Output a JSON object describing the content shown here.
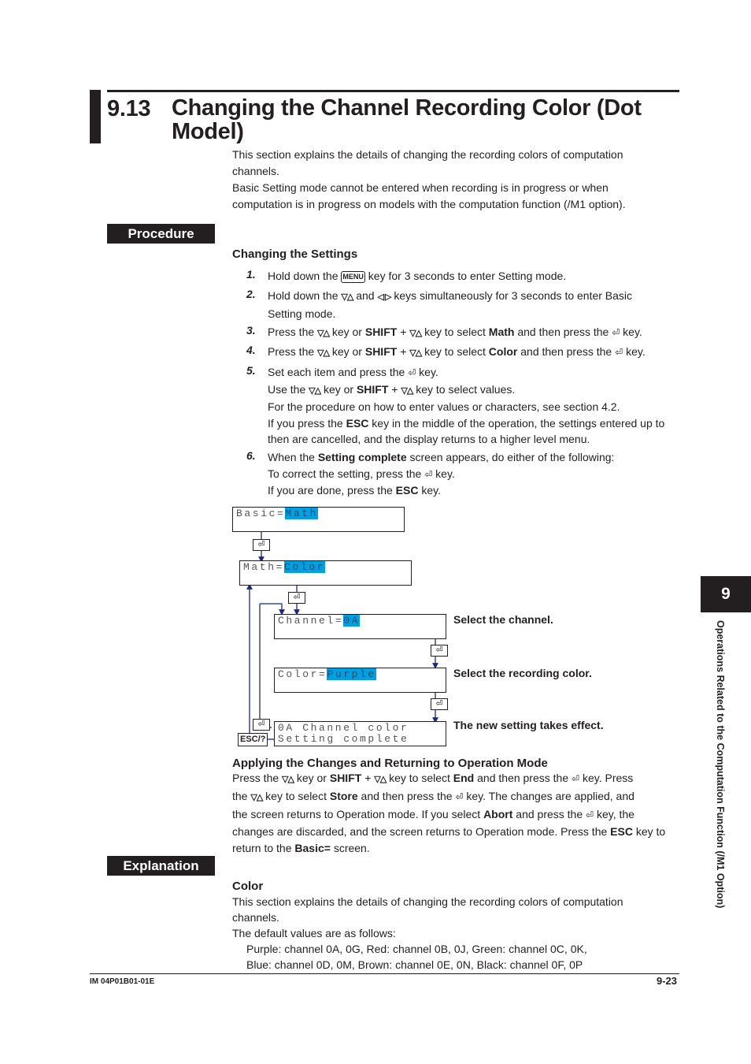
{
  "title": {
    "number": "9.13",
    "text": "Changing the Channel Recording Color (Dot Model)"
  },
  "intro": [
    "This section explains the details of changing the recording colors of computation channels.",
    "Basic Setting mode cannot be entered when recording is in progress or when computation is in progress on models with the computation function (/M1 option)."
  ],
  "procedure": {
    "tab_label": "Procedure",
    "heading": "Changing the Settings",
    "steps": [
      {
        "num": "1.",
        "parts": [
          "Hold down the ",
          "MENU",
          " key for 3 seconds to enter Setting mode."
        ]
      },
      {
        "num": "2.",
        "parts": [
          "Hold down the ",
          "▽△",
          " and ",
          "◁ ▷",
          " keys simultaneously for 3 seconds to enter Basic Setting mode."
        ]
      },
      {
        "num": "3.",
        "parts": [
          "Press the ",
          "▽△",
          " key or ",
          "SHIFT",
          " + ",
          "▽△",
          " key to select ",
          "Math",
          " and then press the ",
          "⏎",
          " key."
        ]
      },
      {
        "num": "4.",
        "parts": [
          "Press the ",
          "▽△",
          " key or ",
          "SHIFT",
          " + ",
          "▽△",
          " key to select ",
          "Color",
          " and then press the ",
          "⏎",
          " key."
        ]
      },
      {
        "num": "5.",
        "lines": [
          [
            "Set each item and press the ",
            "⏎",
            " key."
          ],
          [
            "Use the ",
            "▽△",
            " key or ",
            "SHIFT",
            " + ",
            "▽△",
            " key to select values."
          ],
          [
            "For the procedure on how to enter values or characters, see section 4.2."
          ],
          [
            "If you press the ",
            "ESC",
            " key in the middle of the operation, the settings entered up to"
          ],
          [
            "then are cancelled, and the display returns to a higher level menu."
          ]
        ]
      },
      {
        "num": "6.",
        "lines": [
          [
            "When the ",
            "Setting complete",
            " screen appears, do either of the following:"
          ],
          [
            "To correct the setting, press the ",
            "⏎",
            " key."
          ],
          [
            "If you are done, press the ",
            "ESC",
            " key."
          ]
        ]
      }
    ]
  },
  "diagram": {
    "screens": [
      {
        "prefix": "Basic=",
        "value": "Math"
      },
      {
        "prefix": "Math=",
        "value": "Color"
      },
      {
        "prefix": "Channel=",
        "value": "0A"
      },
      {
        "prefix": "Color=",
        "value": "Purple"
      },
      {
        "line1": "0A Channel color",
        "line2": "Setting complete"
      }
    ],
    "labels": [
      "Select the channel.",
      "Select the recording color.",
      "The new setting takes effect."
    ],
    "esc_key": "ESC/?",
    "enter_key": "⏎",
    "accent_color": "#00a0e0",
    "arrow_color": "#1b2a80"
  },
  "applying": {
    "heading": "Applying the Changes and Returning to Operation Mode",
    "lines": [
      [
        "Press the ",
        "▽△",
        " key or ",
        "SHIFT",
        " + ",
        "▽△",
        " key to select ",
        "End",
        " and then press the ",
        "⏎",
        " key. Press"
      ],
      [
        "the ",
        "▽△",
        " key to select ",
        "Store",
        " and then press the ",
        "⏎",
        " key. The changes are applied, and"
      ],
      [
        "the screen returns to Operation mode. If you select ",
        "Abort",
        " and press the ",
        "⏎",
        " key, the"
      ],
      [
        "changes are discarded, and the screen returns to Operation mode. Press the ",
        "ESC",
        " key to"
      ],
      [
        "return to the ",
        "Basic=",
        " screen."
      ]
    ]
  },
  "explanation": {
    "tab_label": "Explanation",
    "heading": "Color",
    "lines": [
      "This section explains the details of changing the recording colors of computation",
      "channels.",
      "The default values are as follows:",
      "Purple: channel 0A, 0G, Red: channel 0B, 0J, Green: channel 0C, 0K,",
      "Blue: channel 0D, 0M, Brown: channel 0E, 0N, Black: channel 0F, 0P"
    ]
  },
  "side_tab": {
    "number": "9",
    "text": "Operations Related to the Computation Function (/M1 Option)"
  },
  "footer": {
    "doc_id": "IM 04P01B01-01E",
    "page": "9-23"
  }
}
